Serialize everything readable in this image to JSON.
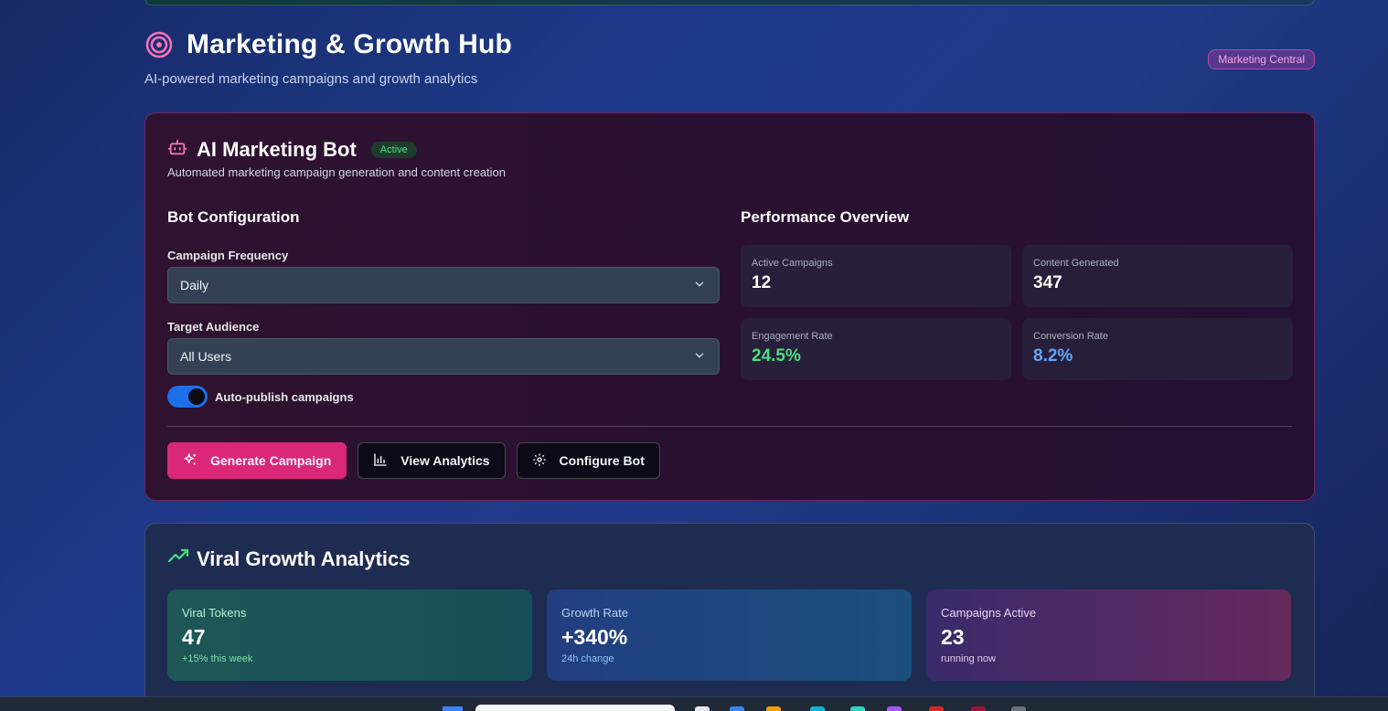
{
  "header": {
    "title": "Marketing & Growth Hub",
    "subtitle": "AI-powered marketing campaigns and growth analytics",
    "badge": "Marketing Central"
  },
  "bot": {
    "title": "AI Marketing Bot",
    "status": "Active",
    "description": "Automated marketing campaign generation and content creation",
    "config": {
      "section_title": "Bot Configuration",
      "frequency_label": "Campaign Frequency",
      "frequency_value": "Daily",
      "audience_label": "Target Audience",
      "audience_value": "All Users",
      "auto_publish_label": "Auto-publish campaigns",
      "auto_publish_on": true
    },
    "performance": {
      "section_title": "Performance Overview",
      "stats": [
        {
          "label": "Active Campaigns",
          "value": "12"
        },
        {
          "label": "Content Generated",
          "value": "347"
        },
        {
          "label": "Engagement Rate",
          "value": "24.5%"
        },
        {
          "label": "Conversion Rate",
          "value": "8.2%"
        }
      ]
    },
    "actions": {
      "generate": "Generate Campaign",
      "analytics": "View Analytics",
      "configure": "Configure Bot"
    }
  },
  "growth": {
    "title": "Viral Growth Analytics",
    "tiles": [
      {
        "label": "Viral Tokens",
        "value": "47",
        "note": "+15% this week"
      },
      {
        "label": "Growth Rate",
        "value": "+340%",
        "note": "24h change"
      },
      {
        "label": "Campaigns Active",
        "value": "23",
        "note": "running now"
      }
    ]
  },
  "colors": {
    "accent_pink": "#db2777",
    "positive_green": "#4ade80",
    "info_blue": "#60a5fa",
    "toggle_blue": "#1d6fe8"
  }
}
